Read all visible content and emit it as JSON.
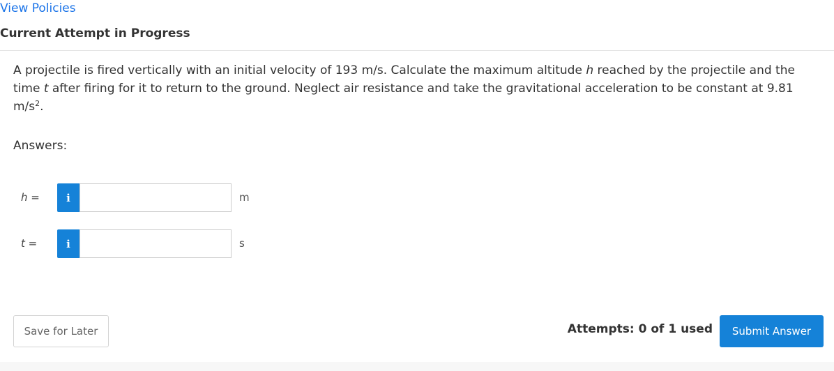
{
  "header": {
    "view_policies_label": "View Policies",
    "section_title": "Current Attempt in Progress"
  },
  "question": {
    "part1": "A projectile is fired vertically with an initial velocity of 193 m/s. Calculate the maximum altitude ",
    "var_h": "h",
    "part2": " reached by the projectile and the time ",
    "var_t": "t",
    "part3": " after firing for it to return to the ground. Neglect air resistance and take the gravitational acceleration to be constant at 9.81 m/s",
    "superscript": "2",
    "part4": "."
  },
  "answers": {
    "label": "Answers:",
    "rows": [
      {
        "var": "h",
        "equals": " =",
        "info_glyph": "i",
        "value": "",
        "unit": "m"
      },
      {
        "var": "t",
        "equals": " =",
        "info_glyph": "i",
        "value": "",
        "unit": "s"
      }
    ]
  },
  "footer": {
    "save_label": "Save for Later",
    "attempts_text": "Attempts: 0 of 1 used",
    "submit_label": "Submit Answer"
  },
  "colors": {
    "accent": "#1582d8",
    "link": "#1a73e8",
    "text": "#333333"
  },
  "icons": {
    "info": "info-icon"
  }
}
